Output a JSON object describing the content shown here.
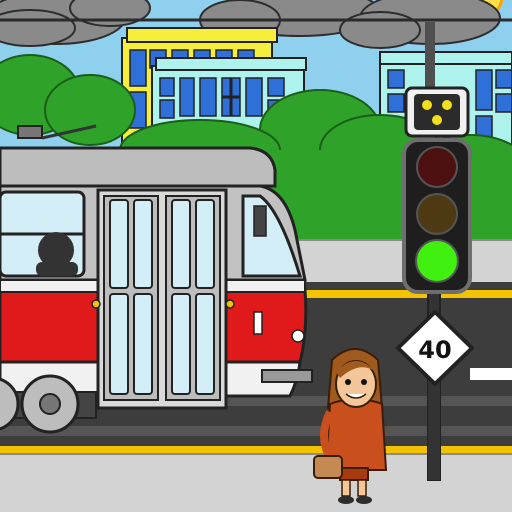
{
  "speed_sign": {
    "value": "40"
  },
  "traffic_light": {
    "active_signal": "green"
  },
  "tram_signal": {
    "pattern": "three-dot-triangle"
  },
  "colors": {
    "sky": "#8fd0ee",
    "tram_red": "#e01a1a",
    "tram_gray": "#c2c2c2",
    "road": "#3d3d3d",
    "road_line": "#f3c300",
    "grass": "#2fa22a",
    "building_yellow": "#f5ee3c",
    "building_blue": "#2f6fd8",
    "light_green": "#3ff011"
  },
  "icons": {
    "tram": "tram-icon",
    "traffic_light": "traffic-light-icon",
    "speed_sign": "speed-limit-sign-icon",
    "pedestrian": "pedestrian-woman-icon",
    "sun": "sun-icon"
  }
}
